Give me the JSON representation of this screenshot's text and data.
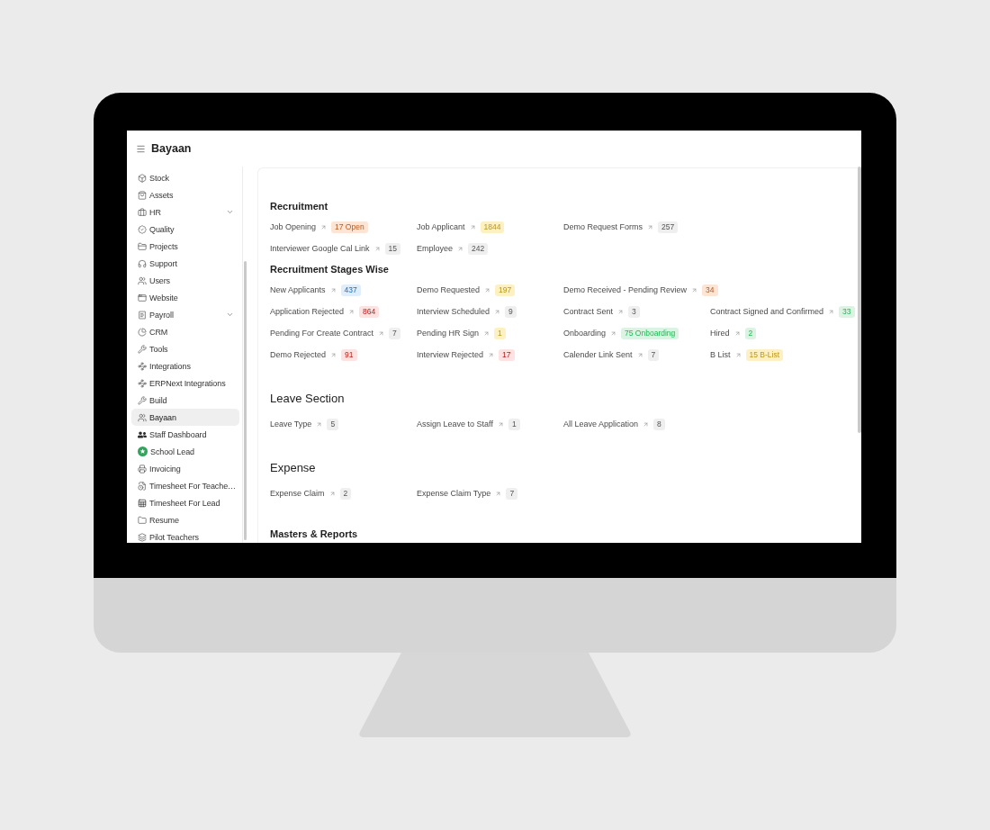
{
  "app": {
    "title": "Bayaan"
  },
  "sidebar": {
    "items": [
      {
        "label": "Stock",
        "kind": "link",
        "selected": false
      },
      {
        "label": "Assets",
        "kind": "link",
        "selected": false
      },
      {
        "label": "HR",
        "kind": "group",
        "selected": false
      },
      {
        "label": "Quality",
        "kind": "link",
        "selected": false
      },
      {
        "label": "Projects",
        "kind": "link",
        "selected": false
      },
      {
        "label": "Support",
        "kind": "link",
        "selected": false
      },
      {
        "label": "Users",
        "kind": "link",
        "selected": false
      },
      {
        "label": "Website",
        "kind": "link",
        "selected": false
      },
      {
        "label": "Payroll",
        "kind": "group",
        "selected": false
      },
      {
        "label": "CRM",
        "kind": "link",
        "selected": false
      },
      {
        "label": "Tools",
        "kind": "link",
        "selected": false
      },
      {
        "label": "Integrations",
        "kind": "link",
        "selected": false
      },
      {
        "label": "ERPNext Integrations",
        "kind": "link",
        "selected": false
      },
      {
        "label": "Build",
        "kind": "link",
        "selected": false
      },
      {
        "label": "Bayaan",
        "kind": "link",
        "selected": true
      },
      {
        "label": "Staff Dashboard",
        "kind": "link",
        "selected": false
      },
      {
        "label": "School Lead",
        "kind": "link",
        "selected": false
      },
      {
        "label": "Invoicing",
        "kind": "link",
        "selected": false
      },
      {
        "label": "Timesheet For Teache…",
        "kind": "link",
        "selected": false
      },
      {
        "label": "Timesheet For Lead",
        "kind": "link",
        "selected": false
      },
      {
        "label": "Resume",
        "kind": "link",
        "selected": false
      },
      {
        "label": "Pilot Teachers",
        "kind": "link",
        "selected": false
      }
    ]
  },
  "sections": [
    {
      "kind": "card",
      "title": "Recruitment",
      "rows": [
        [
          {
            "label": "Job Opening",
            "count": "17 Open",
            "color": "#fde5d6"
          },
          {
            "label": "Job Applicant",
            "count": "1844",
            "color": "#fdf1c4"
          },
          {
            "label": "Demo Request Forms",
            "count": "257",
            "color": "#efefef"
          }
        ],
        [
          {
            "label": "Interviewer Google Cal Link",
            "count": "15",
            "color": "#efefef"
          },
          {
            "label": "Employee",
            "count": "242",
            "color": "#efefef"
          }
        ]
      ]
    },
    {
      "kind": "card",
      "title": "Recruitment Stages Wise",
      "rows": [
        [
          {
            "label": "New Applicants",
            "count": "437",
            "color": "#e0eefc"
          },
          {
            "label": "Demo Requested",
            "count": "197",
            "color": "#fdf1c4"
          },
          {
            "label": "Demo Received - Pending Review",
            "count": "34",
            "color": "#fde5d6"
          }
        ],
        [
          {
            "label": "Application Rejected",
            "count": "864",
            "color": "#fde2e2"
          },
          {
            "label": "Interview Scheduled",
            "count": "9",
            "color": "#efefef"
          },
          {
            "label": "Contract Sent",
            "count": "3",
            "color": "#efefef"
          },
          {
            "label": "Contract Signed and Confirmed",
            "count": "33",
            "color": "#dcf3e4"
          }
        ],
        [
          {
            "label": "Pending For Create Contract",
            "count": "7",
            "color": "#efefef"
          },
          {
            "label": "Pending HR Sign",
            "count": "1",
            "color": "#fdf1c4"
          },
          {
            "label": "Onboarding",
            "count": "75 Onboarding",
            "color": "#dcf3e4"
          },
          {
            "label": "Hired",
            "count": "2",
            "color": "#dcf3e4"
          }
        ],
        [
          {
            "label": "Demo Rejected",
            "count": "91",
            "color": "#fde2e2"
          },
          {
            "label": "Interview Rejected",
            "count": "17",
            "color": "#fde2e2"
          },
          {
            "label": "Calender Link Sent",
            "count": "7",
            "color": "#efefef"
          },
          {
            "label": "B List",
            "count": "15 B-List",
            "color": "#fdf1c4"
          }
        ]
      ]
    },
    {
      "kind": "heading",
      "title": "Leave Section",
      "rows": [
        [
          {
            "label": "Leave Type",
            "count": "5",
            "color": "#efefef"
          },
          {
            "label": "Assign Leave to Staff",
            "count": "1",
            "color": "#efefef"
          },
          {
            "label": "All Leave Application",
            "count": "8",
            "color": "#efefef"
          }
        ]
      ]
    },
    {
      "kind": "heading",
      "title": "Expense",
      "rows": [
        [
          {
            "label": "Expense Claim",
            "count": "2",
            "color": "#efefef"
          },
          {
            "label": "Expense Claim Type",
            "count": "7",
            "color": "#efefef"
          }
        ]
      ]
    },
    {
      "kind": "card",
      "title": "Masters & Reports"
    }
  ]
}
